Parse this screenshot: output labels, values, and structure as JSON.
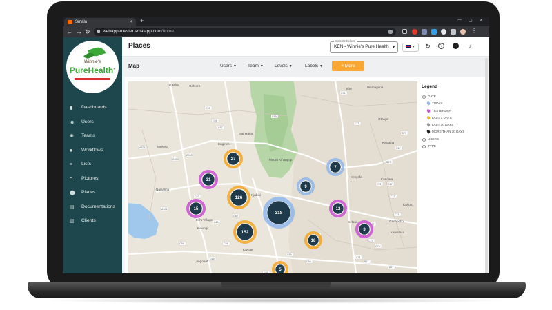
{
  "browser": {
    "tab_title": "Smala",
    "new_tab": "+",
    "url_host": "webapp-master.smalapp.com",
    "url_path": "/home",
    "nav_back": "←",
    "nav_forward": "→",
    "nav_reload": "↻",
    "window_minimize": "—",
    "window_maximize": "▢",
    "window_close": "✕"
  },
  "logo": {
    "tagline": "Winnie's",
    "brand": "PureHealth",
    "registered": "®"
  },
  "sidebar": {
    "items": [
      {
        "label": "Dashboards",
        "icon": "bar-chart-icon",
        "glyph": "▮"
      },
      {
        "label": "Users",
        "icon": "users-icon",
        "glyph": "☻"
      },
      {
        "label": "Teams",
        "icon": "teams-icon",
        "glyph": "✺"
      },
      {
        "label": "Workflows",
        "icon": "briefcase-icon",
        "glyph": "■"
      },
      {
        "label": "Lists",
        "icon": "list-icon",
        "glyph": "≡"
      },
      {
        "label": "Pictures",
        "icon": "camera-icon",
        "glyph": "◘"
      },
      {
        "label": "Places",
        "icon": "map-pin-icon",
        "glyph": "⬤"
      },
      {
        "label": "Documentations",
        "icon": "document-icon",
        "glyph": "▤"
      },
      {
        "label": "Clients",
        "icon": "building-icon",
        "glyph": "▥"
      }
    ]
  },
  "header": {
    "title": "Places",
    "selected_client_label": "Selected client",
    "selected_client_value": "KEN - Winnie's Pure Health",
    "language_caret": "▾"
  },
  "toolbar": {
    "title": "Map",
    "filters": [
      "Users",
      "Team",
      "Levels",
      "Labels"
    ],
    "more_label": "+ More"
  },
  "legend": {
    "title": "Legend",
    "groups": [
      {
        "label": "DATE",
        "selected": true
      },
      {
        "label": "USERS",
        "selected": false
      },
      {
        "label": "TYPE",
        "selected": false
      }
    ],
    "date_items": [
      {
        "label": "TODAY",
        "color": "#8fb6ea"
      },
      {
        "label": "YESTERDAY",
        "color": "#c94fd1"
      },
      {
        "label": "LAST 7 DAYS",
        "color": "#f5b731"
      },
      {
        "label": "LAST 30 DAYS",
        "color": "#9b9b9b"
      },
      {
        "label": "MORE THAN 30 DAYS",
        "color": "#222222"
      }
    ]
  },
  "map": {
    "places": [
      "Turasha",
      "Githioro",
      "Mai Mahiu",
      "Engineer",
      "Melewa",
      "Naivasha",
      "Hell's Village",
      "Kinungi",
      "Longonot",
      "Njabini",
      "Kamae",
      "Mount Kinangop",
      "Ithe",
      "Wamagana",
      "Othaya",
      "Karatina",
      "Kenyafa",
      "Kandara",
      "Kahuro",
      "Gachocho",
      "Sefani",
      "KANGEMA"
    ],
    "road_labels": [
      "C67",
      "C67",
      "C69",
      "C69",
      "A104",
      "D392",
      "D393",
      "C68",
      "A104",
      "C69",
      "C68",
      "C69",
      "A104",
      "C67",
      "C69",
      "C69",
      "C71",
      "C69",
      "C71",
      "C71",
      "B27",
      "C67",
      "B27",
      "C67",
      "C72",
      "C71",
      "B27",
      "B27",
      "B27",
      "C73",
      "C73",
      "C71",
      "C71"
    ],
    "clusters": [
      {
        "count": "27",
        "color": "#f5a623"
      },
      {
        "count": "31",
        "color": "#c94fd1"
      },
      {
        "count": "126",
        "color": "#f5a623"
      },
      {
        "count": "15",
        "color": "#c94fd1"
      },
      {
        "count": "152",
        "color": "#f5a623"
      },
      {
        "count": "318",
        "color": "#8fb6ea"
      },
      {
        "count": "9",
        "color": "#8fb6ea"
      },
      {
        "count": "7",
        "color": "#8fb6ea"
      },
      {
        "count": "12",
        "color": "#c94fd1"
      },
      {
        "count": "3",
        "color": "#c94fd1"
      },
      {
        "count": "18",
        "color": "#f5a623"
      },
      {
        "count": "5",
        "color": "#f5a623"
      }
    ]
  },
  "colors": {
    "sidebar": "#1d474c",
    "accent": "#f7a734",
    "brand_green": "#3aa935"
  }
}
